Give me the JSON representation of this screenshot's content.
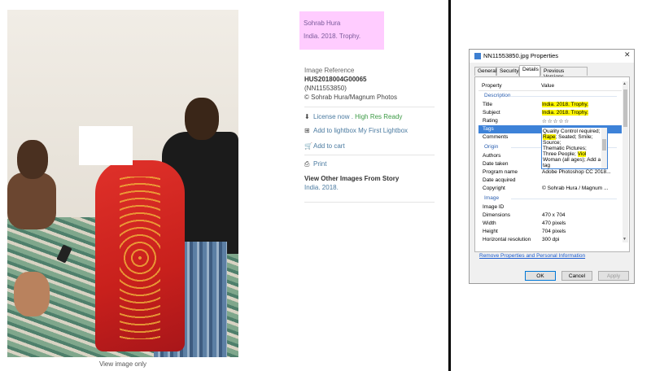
{
  "left_panel": {
    "view_image_only": "View image only"
  },
  "info": {
    "caption_line1": "Sohrab Hura",
    "caption_line2": "India. 2018. Trophy.",
    "reference_label": "Image Reference",
    "reference_code": "HUS2018004G00065",
    "reference_sub": "(NN11553850)",
    "copyright": "© Sohrab Hura/Magnum Photos",
    "license_text": "License now",
    "license_sep": " . ",
    "high_res": "High Res Ready",
    "lightbox": "Add to lightbox My First Lightbox",
    "cart": "Add to cart",
    "print": "Print",
    "story_title": "View Other Images From Story",
    "story_link": "India. 2018."
  },
  "dialog": {
    "title": "NN11553850.jpg Properties",
    "close": "✕",
    "tabs": [
      "General",
      "Security",
      "Details",
      "Previous Versions"
    ],
    "header_property": "Property",
    "header_value": "Value",
    "section_description": "Description",
    "section_origin": "Origin",
    "section_image": "Image",
    "rows": {
      "title_k": "Title",
      "title_v": "India. 2018. Trophy.",
      "subject_k": "Subject",
      "subject_v": "India. 2018. Trophy.",
      "rating_k": "Rating",
      "rating_v": "☆☆☆☆☆",
      "tags_k": "Tags",
      "comments_k": "Comments",
      "authors_k": "Authors",
      "datetaken_k": "Date taken",
      "program_k": "Program name",
      "program_v": "Adobe Photoshop CC 2018...",
      "dateacq_k": "Date acquired",
      "copyright_k": "Copyright",
      "copyright_v": "© Sohrab Hura / Magnum ...",
      "imageid_k": "Image ID",
      "dimensions_k": "Dimensions",
      "dimensions_v": "470 x 704",
      "width_k": "Width",
      "width_v": "470 pixels",
      "height_k": "Height",
      "height_v": "704 pixels",
      "hres_k": "Horizontal resolution",
      "hres_v": "300 dpi"
    },
    "tags_lines": {
      "l1": "Quality Control required;",
      "l2a": "Rape",
      "l2b": "; Seated; Smile;",
      "l3": "Source;",
      "l4": "Thematic Pictures;",
      "l5a": "Three People; ",
      "l5b": "Viol",
      "l6": "Woman (all ages); Add a",
      "l7": "tag"
    },
    "remove_link": "Remove Properties and Personal Information",
    "ok": "OK",
    "cancel": "Cancel",
    "apply": "Apply"
  },
  "colors": {
    "caption_bg": "#ffccff",
    "highlight": "#fff700",
    "selection": "#3d82d8",
    "link": "#4a7aa0",
    "high_res": "#3c9a45"
  }
}
